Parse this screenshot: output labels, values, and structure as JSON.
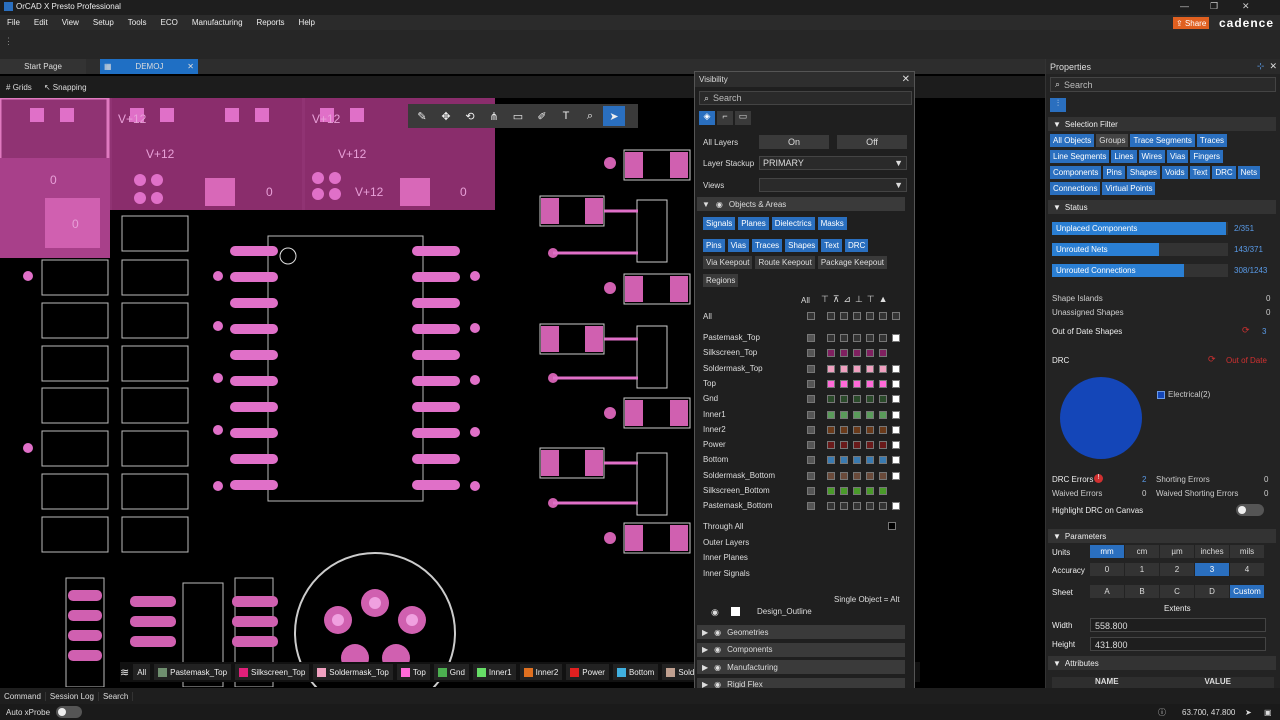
{
  "app": {
    "title": "OrCAD X Presto Professional",
    "brand": "cadence",
    "share_label": "Share"
  },
  "menu": [
    "File",
    "Edit",
    "View",
    "Setup",
    "Tools",
    "ECO",
    "Manufacturing",
    "Reports",
    "Help"
  ],
  "tabs": [
    {
      "label": "Start Page"
    },
    {
      "label": "DEMOJ"
    }
  ],
  "subbar": {
    "grids": "Grids",
    "snapping": "Snapping"
  },
  "canvas": {
    "labels": [
      "V+12",
      "V+12",
      "V+12",
      "V+12",
      "V+12",
      "0",
      "0",
      "0",
      "0"
    ]
  },
  "layerbar": {
    "all": "All",
    "layers": [
      {
        "name": "Pastemask_Top",
        "color": "#6f8f6f"
      },
      {
        "name": "Silkscreen_Top",
        "color": "#e0207a"
      },
      {
        "name": "Soldermask_Top",
        "color": "#f0a0c0"
      },
      {
        "name": "Top",
        "color": "#ff6ad8"
      },
      {
        "name": "Gnd",
        "color": "#4caf50"
      },
      {
        "name": "Inner1",
        "color": "#66dd66"
      },
      {
        "name": "Inner2",
        "color": "#e07020"
      },
      {
        "name": "Power",
        "color": "#e02020"
      },
      {
        "name": "Bottom",
        "color": "#40b0e0"
      },
      {
        "name": "Solde",
        "color": "#c0a090"
      }
    ]
  },
  "bottom_tabs": [
    "Command",
    "Session Log",
    "Search"
  ],
  "status": {
    "auto_xprobe": "Auto xProbe",
    "coords": "63.700, 47.800"
  },
  "visibility": {
    "title": "Visibility",
    "search_placeholder": "Search",
    "all_layers_label": "All Layers",
    "on_label": "On",
    "off_label": "Off",
    "layer_stackup_label": "Layer Stackup",
    "layer_stackup_value": "PRIMARY",
    "views_label": "Views",
    "objects_areas": "Objects & Areas",
    "chips_row1": [
      "Signals",
      "Planes",
      "Dielectrics",
      "Masks"
    ],
    "chips_row2": [
      "Pins",
      "Vias",
      "Traces",
      "Shapes",
      "Text",
      "DRC"
    ],
    "chips_row3": [
      "Via Keepout",
      "Route Keepout",
      "Package Keepout"
    ],
    "chips_row4": [
      "Regions"
    ],
    "all_col": "All",
    "all_row": "All",
    "layers": [
      "Pastemask_Top",
      "Silkscreen_Top",
      "Soldermask_Top",
      "Top",
      "Gnd",
      "Inner1",
      "Inner2",
      "Power",
      "Bottom",
      "Soldermask_Bottom",
      "Silkscreen_Bottom",
      "Pastemask_Bottom"
    ],
    "extra_rows": [
      "Through All",
      "Outer Layers",
      "Inner Planes",
      "Inner Signals"
    ],
    "single_object": "Single Object = Alt",
    "design_outline": "Design_Outline",
    "groups": [
      "Geometries",
      "Components",
      "Manufacturing",
      "Rigid Flex"
    ]
  },
  "properties": {
    "title": "Properties",
    "search_placeholder": "Search",
    "selection_filter": "Selection Filter",
    "filter_chips": [
      "All Objects",
      "Groups",
      "Trace Segments",
      "Traces",
      "Line Segments",
      "Lines",
      "Wires",
      "Vias",
      "Fingers",
      "Components",
      "Pins",
      "Shapes",
      "Voids",
      "Text",
      "DRC",
      "Nets",
      "Connections",
      "Virtual Points"
    ],
    "status_label": "Status",
    "status_bars": [
      {
        "label": "Unplaced Components",
        "value": "2/351",
        "fraction": 0.99
      },
      {
        "label": "Unrouted Nets",
        "value": "143/371",
        "fraction": 0.61
      },
      {
        "label": "Unrouted Connections",
        "value": "308/1243",
        "fraction": 0.75
      }
    ],
    "shape_islands": "Shape Islands",
    "shape_islands_val": "0",
    "unassigned_shapes": "Unassigned Shapes",
    "unassigned_shapes_val": "0",
    "out_of_date_shapes": "Out of Date Shapes",
    "out_of_date_shapes_val": "3",
    "drc_label": "DRC",
    "drc_out_of_date": "Out of Date",
    "drc_legend": "Electrical(2)",
    "drc_errors": "DRC Errors",
    "drc_errors_val": "2",
    "shorting_errors": "Shorting Errors",
    "shorting_errors_val": "0",
    "waived_errors": "Waived Errors",
    "waived_errors_val": "0",
    "waived_shorting": "Waived Shorting Errors",
    "waived_shorting_val": "0",
    "highlight_drc": "Highlight DRC on Canvas",
    "parameters": "Parameters",
    "units_label": "Units",
    "units": [
      "mm",
      "cm",
      "µm",
      "inches",
      "mils"
    ],
    "accuracy_label": "Accuracy",
    "accuracy": [
      "0",
      "1",
      "2",
      "3",
      "4"
    ],
    "sheet_label": "Sheet",
    "sheets": [
      "A",
      "B",
      "C",
      "D",
      "Custom"
    ],
    "extents": "Extents",
    "width_label": "Width",
    "width_val": "558.800",
    "height_label": "Height",
    "height_val": "431.800",
    "attributes": "Attributes",
    "attr_cols": [
      "NAME",
      "VALUE"
    ]
  }
}
